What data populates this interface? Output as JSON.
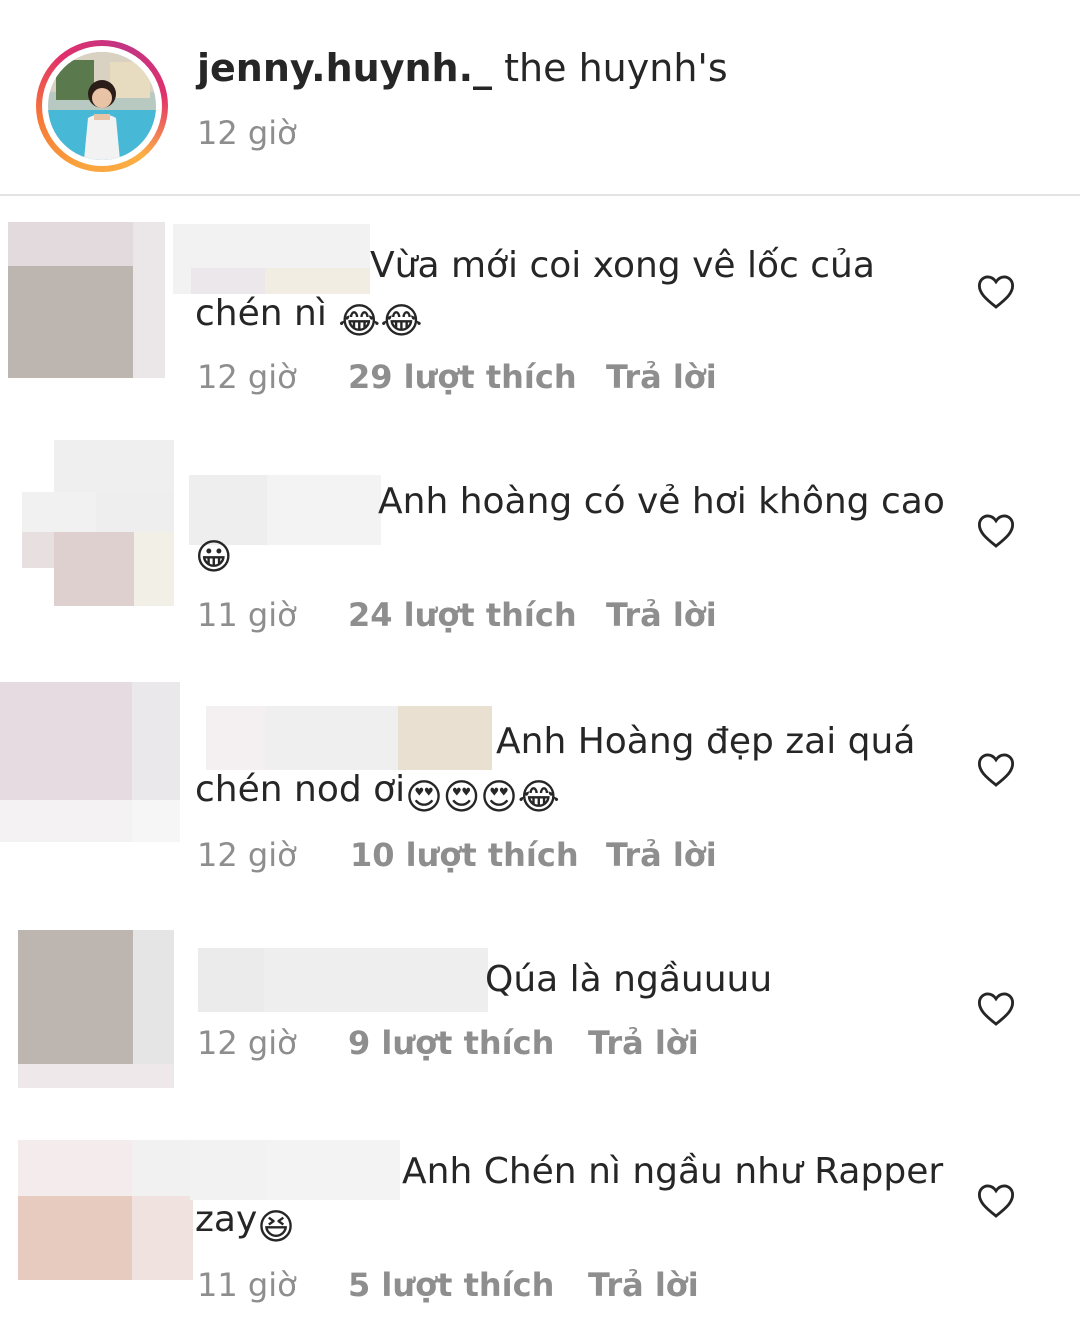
{
  "post": {
    "username": "jenny.huynh._",
    "caption": "the huynh's",
    "time": "12 giờ"
  },
  "comments": [
    {
      "text": "Vừa mới coi xong vê lốc của",
      "text2": "chén nì",
      "emojis": [
        "😂",
        "😂"
      ],
      "time": "12 giờ",
      "likes": "29 lượt thích",
      "reply": "Trả lời"
    },
    {
      "text": "Anh hoàng có vẻ hơi không cao",
      "text2": "",
      "emojis": [
        "😀"
      ],
      "time": "11 giờ",
      "likes": "24 lượt thích",
      "reply": "Trả lời"
    },
    {
      "text": "Anh Hoàng đẹp zai quá",
      "text2": "chén nod ơi",
      "emojis": [
        "😍",
        "😍",
        "😍",
        "😂"
      ],
      "time": "12 giờ",
      "likes": "10 lượt thích",
      "reply": "Trả lời"
    },
    {
      "text": "Qúa là ngầuuuu",
      "text2": "",
      "emojis": [],
      "time": "12 giờ",
      "likes": "9 lượt thích",
      "reply": "Trả lời"
    },
    {
      "text": "Anh Chén nì ngầu như Rapper",
      "text2": "zay",
      "emojis": [
        "😆"
      ],
      "time": "11 giờ",
      "likes": "5 lượt thích",
      "reply": "Trả lời"
    }
  ],
  "icons": {
    "like": "heart-outline-icon"
  },
  "colors": {
    "secondary_text": "#8e8e8e",
    "primary_text": "#262626",
    "divider": "#e3e3e3"
  }
}
